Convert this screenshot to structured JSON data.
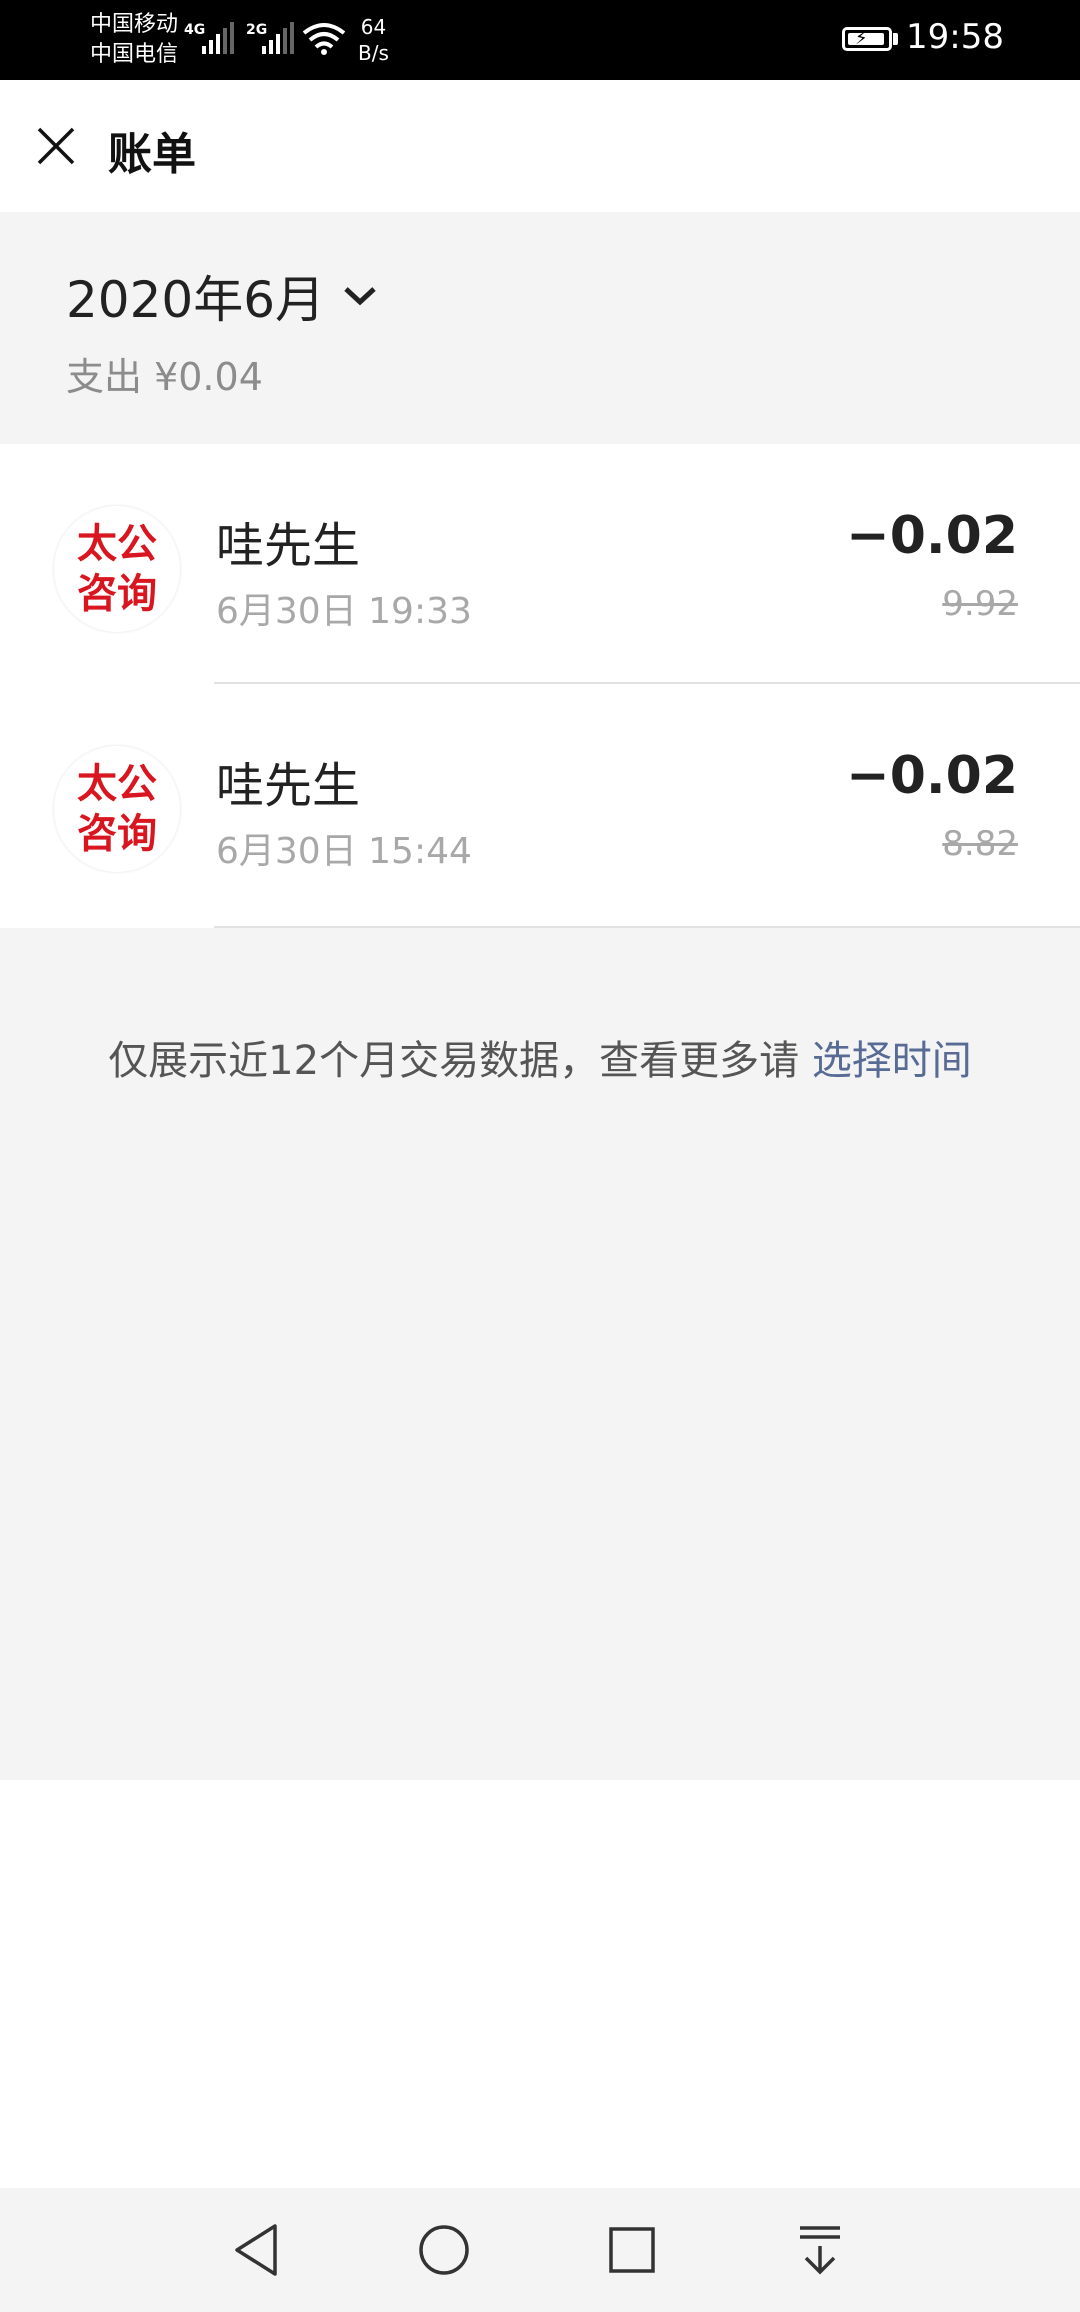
{
  "status_bar": {
    "carrier_1": "中国移动",
    "carrier_2": "中国电信",
    "net_1": "4G",
    "net_2": "2G",
    "speed_value": "64",
    "speed_unit": "B/s",
    "time": "19:58",
    "icons": [
      "signal-icon",
      "wifi-icon",
      "battery-charging-icon"
    ]
  },
  "header": {
    "title": "账单",
    "close_icon": "close-icon"
  },
  "summary": {
    "month": "2020年6月",
    "expense": "支出 ¥0.04",
    "dropdown_icon": "chevron-down-icon"
  },
  "transactions": [
    {
      "avatar_line1": "太公",
      "avatar_line2": "咨询",
      "merchant": "哇先生",
      "time": "6月30日 19:33",
      "amount": "−0.02",
      "balance": "9.92"
    },
    {
      "avatar_line1": "太公",
      "avatar_line2": "咨询",
      "merchant": "哇先生",
      "time": "6月30日 15:44",
      "amount": "−0.02",
      "balance": "8.82"
    }
  ],
  "footer_note": {
    "text": "仅展示近12个月交易数据，查看更多请 ",
    "link": "选择时间"
  },
  "colors": {
    "avatar_red": "#d9151f",
    "link_blue": "#576b95",
    "background_gray": "#f4f4f4"
  },
  "nav_bar": {
    "icons": [
      "back-icon",
      "home-icon",
      "recents-icon",
      "notification-pulldown-icon"
    ]
  }
}
